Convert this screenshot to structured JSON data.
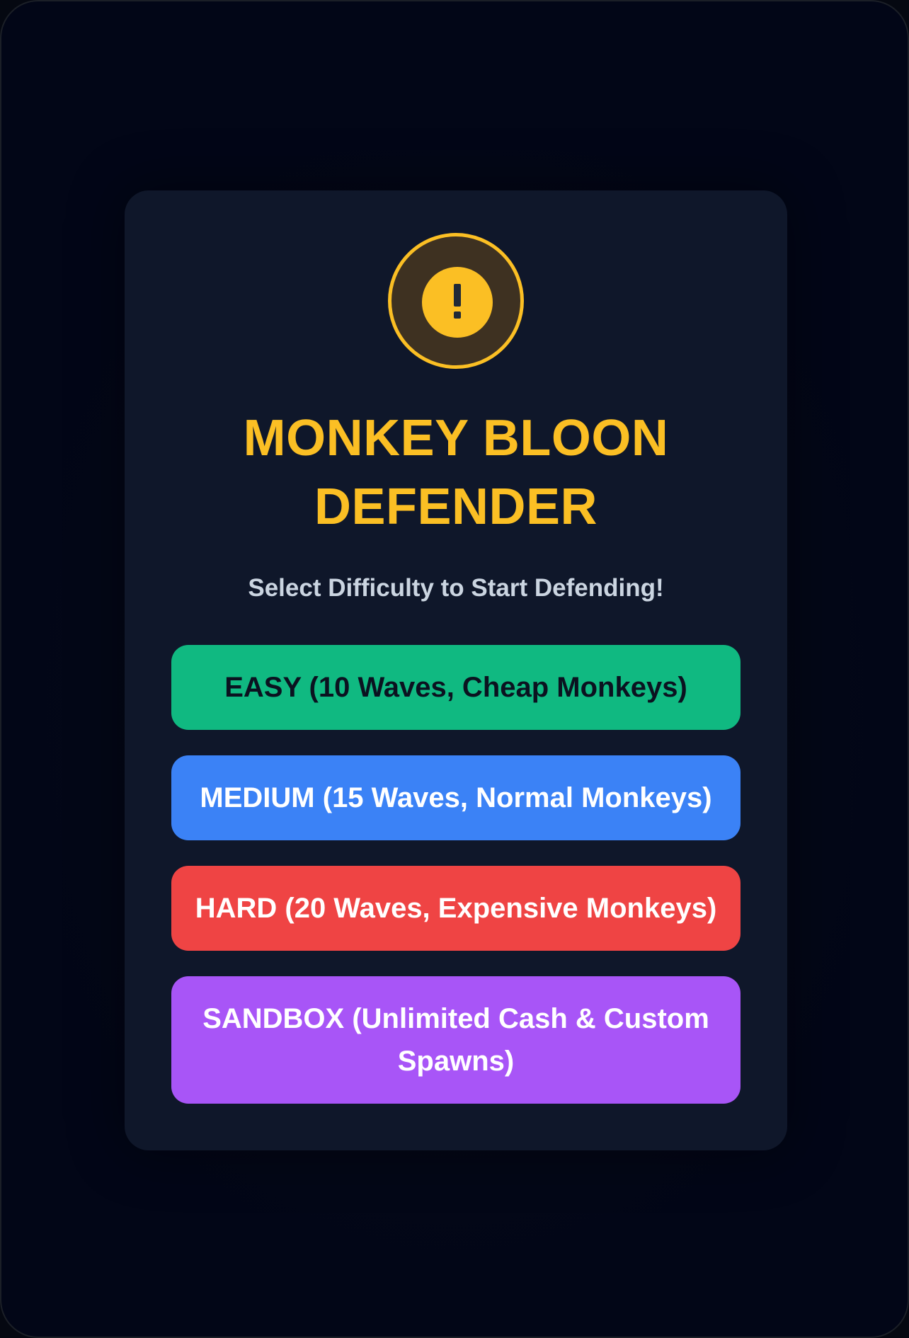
{
  "app": {
    "title_lines": [
      "MONKEY BLOON",
      "DEFENDER"
    ],
    "subtitle": "Select Difficulty to Start Defending!",
    "icon": "warning-exclamation-icon"
  },
  "difficulties": [
    {
      "id": "easy",
      "label": "EASY (10 Waves, Cheap Monkeys)",
      "color": "#10b981"
    },
    {
      "id": "medium",
      "label": "MEDIUM (15 Waves, Normal Monkeys)",
      "color": "#3b82f6"
    },
    {
      "id": "hard",
      "label": "HARD (20 Waves, Expensive Monkeys)",
      "color": "#ef4444"
    },
    {
      "id": "sandbox",
      "label": "SANDBOX (Unlimited Cash & Custom Spawns)",
      "color": "#a855f7"
    }
  ],
  "theme": {
    "accent": "#fbbf24",
    "card_background": "#0f172a",
    "page_background": "#020617"
  }
}
